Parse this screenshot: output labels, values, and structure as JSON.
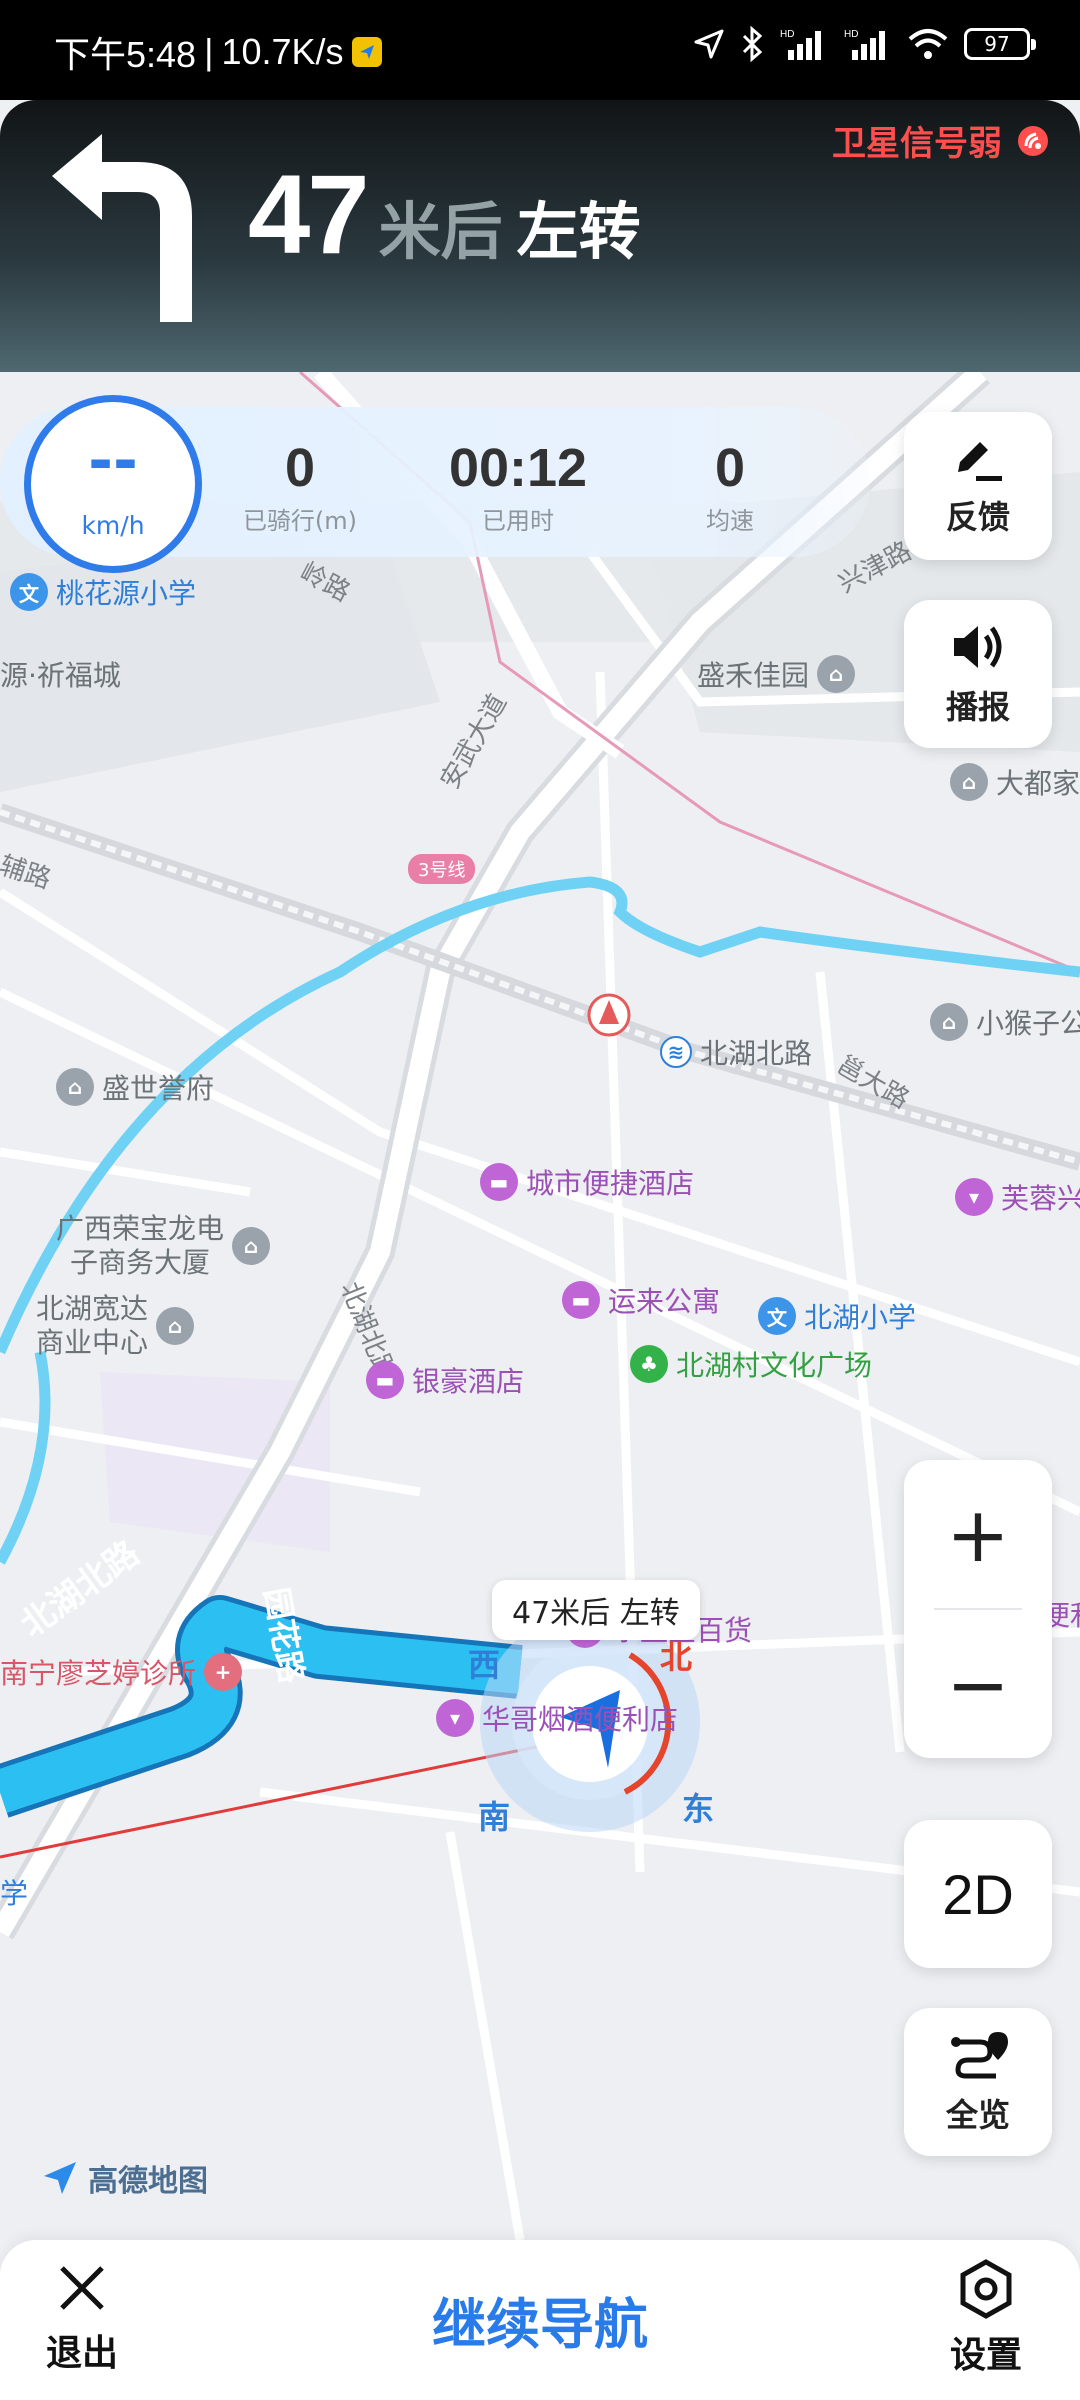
{
  "status_bar": {
    "time": "下午5:48",
    "net_speed": "10.7K/s",
    "battery": "97",
    "icons": [
      "location-arrow-icon",
      "bluetooth-icon",
      "signal-hd-icon",
      "signal-hd-icon",
      "wifi-icon",
      "battery-icon"
    ]
  },
  "navigation": {
    "satellite_warning": "卫星信号弱",
    "distance": "47",
    "distance_unit": "米后",
    "action": "左转",
    "turn_icon": "turn-left-arrow-icon"
  },
  "speed_panel": {
    "speed": "--",
    "speed_unit": "km/h",
    "stats": [
      {
        "value": "0",
        "label": "已骑行(m)"
      },
      {
        "value": "00:12",
        "label": "已用时"
      },
      {
        "value": "0",
        "label": "均速"
      }
    ]
  },
  "side_buttons": {
    "feedback": {
      "label": "反馈",
      "icon": "pen-edit-icon"
    },
    "broadcast": {
      "label": "播报",
      "icon": "speaker-icon"
    },
    "zoom_in": "+",
    "zoom_out": "−",
    "view_mode": "2D",
    "overview": {
      "label": "全览",
      "icon": "route-overview-icon"
    }
  },
  "map": {
    "pois": {
      "taohuayuan_school": "桃花源小学",
      "qifucheng": "源·祈福城",
      "shenghe": "盛禾佳园",
      "dadujia": "大都家",
      "xiaohouzi": "小猴子公",
      "shengshi": "盛世誉府",
      "beihu_north_station": "北湖北路",
      "city_hotel": "城市便捷酒店",
      "furong": "芙蓉兴",
      "guangxi_line1": "广西荣宝龙电",
      "guangxi_line2": "子商务大厦",
      "beihu_kuanda_line1": "北湖宽达",
      "beihu_kuanda_line2": "商业中心",
      "yunlai": "运来公寓",
      "beihu_school": "北湖小学",
      "culture_square": "北湖村文化广场",
      "yinhao_hotel": "银豪酒店",
      "shuilanxing": "水蓝星百货",
      "clinic": "南宁廖芝婷诊所",
      "huage": "华哥烟酒便利店",
      "right_edge": "便利",
      "left_edge": "学"
    },
    "roads": {
      "xingjin": "兴津路",
      "anwu": "安武大道",
      "metro": "3号线",
      "beihu_north_road": "北湖北路",
      "yiling": "邕大路",
      "beihu_road": "北湖北路",
      "huayuan": "园花路",
      "route_label": "北湖北路",
      "linglu": "岭路",
      "fulu": "辅路"
    },
    "route_callout": "47米后 左转",
    "compass": {
      "north": "北",
      "south": "南",
      "east": "东",
      "west": "西"
    },
    "brand": "高德地图"
  },
  "bottom_bar": {
    "exit": {
      "label": "退出",
      "icon": "close-x-icon"
    },
    "continue": "继续导航",
    "settings": {
      "label": "设置",
      "icon": "hexagon-settings-icon"
    }
  },
  "colors": {
    "accent_blue": "#2a7bea",
    "route_blue": "#26a9e8",
    "warning_red": "#ff4e4e",
    "water": "#6fd2f5"
  }
}
